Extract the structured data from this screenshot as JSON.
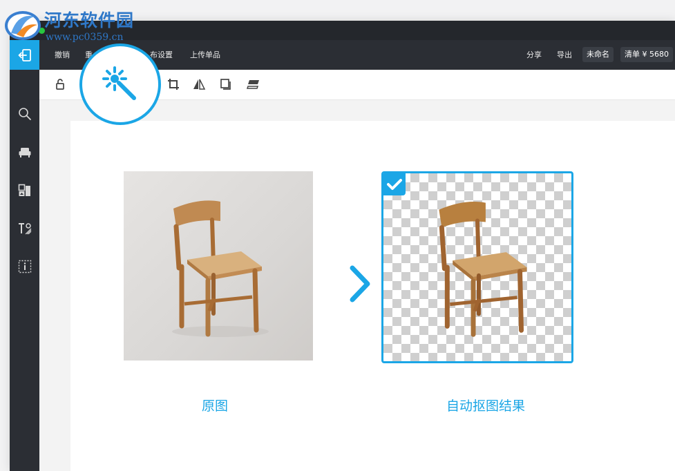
{
  "watermark": {
    "title": "河东软件园",
    "url": "www.pc0359.cn"
  },
  "menu": {
    "undo": "撤销",
    "item2": "重",
    "layout": "布设置",
    "upload": "上传单品",
    "share": "分享",
    "export": "导出",
    "unnamed": "未命名",
    "list": "清单 ¥ 5680"
  },
  "captions": {
    "original": "原图",
    "result": "自动抠图结果"
  },
  "icons": {
    "exit": "exit-icon",
    "search": "search-icon",
    "sofa": "sofa-icon",
    "gallery": "image-library-icon",
    "text": "text-style-icon",
    "info": "info-frame-icon",
    "unlock": "unlock-icon",
    "magic_wand": "magic-wand-icon",
    "crop": "crop-icon",
    "flip": "flip-icon",
    "copy": "duplicate-icon",
    "layers": "layers-icon",
    "check": "check-icon",
    "arrow": "chevron-right-icon"
  },
  "colors": {
    "accent": "#1ba6e6",
    "dark": "#2b2e34",
    "watermark": "#2f78c8"
  }
}
